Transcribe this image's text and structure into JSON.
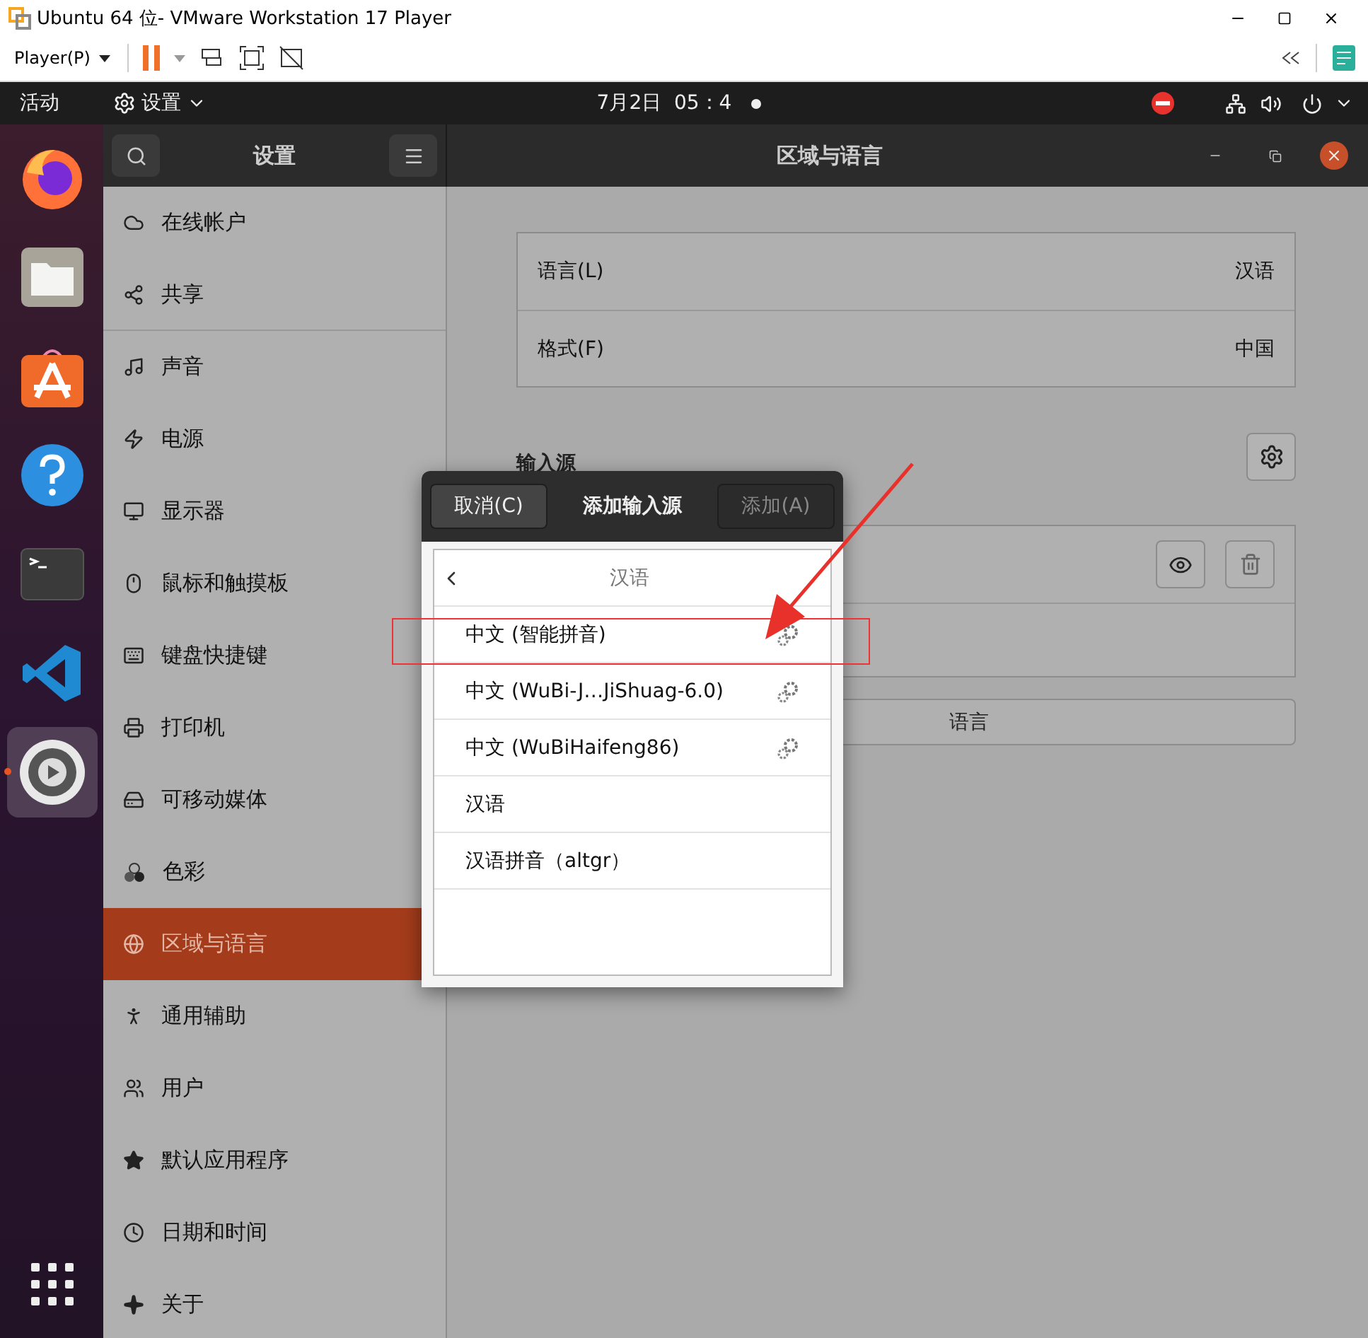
{
  "window": {
    "title": "Ubuntu 64 位- VMware Workstation 17 Player"
  },
  "vm_toolbar": {
    "player_menu": "Player(P)"
  },
  "top_bar": {
    "activities": "活动",
    "app_menu": "设置",
    "clock": "7月2日  05：4"
  },
  "dock": {
    "items": [
      {
        "kind": "firefox",
        "selected": false
      },
      {
        "kind": "files",
        "selected": false
      },
      {
        "kind": "store",
        "selected": false
      },
      {
        "kind": "help",
        "selected": false
      },
      {
        "kind": "terminal",
        "selected": false
      },
      {
        "kind": "vscode",
        "selected": false
      },
      {
        "kind": "settings",
        "selected": true
      }
    ]
  },
  "sidebar": {
    "title": "设置",
    "items": [
      {
        "label": "在线帐户",
        "selected": false
      },
      {
        "label": "共享",
        "selected": false
      },
      {
        "label": "声音",
        "selected": false
      },
      {
        "label": "电源",
        "selected": false
      },
      {
        "label": "显示器",
        "selected": false
      },
      {
        "label": "鼠标和触摸板",
        "selected": false
      },
      {
        "label": "键盘快捷键",
        "selected": false
      },
      {
        "label": "打印机",
        "selected": false
      },
      {
        "label": "可移动媒体",
        "selected": false
      },
      {
        "label": "色彩",
        "selected": false
      },
      {
        "label": "区域与语言",
        "selected": true
      },
      {
        "label": "通用辅助",
        "selected": false
      },
      {
        "label": "用户",
        "selected": false
      },
      {
        "label": "默认应用程序",
        "selected": false
      },
      {
        "label": "日期和时间",
        "selected": false
      },
      {
        "label": "关于",
        "selected": false
      }
    ]
  },
  "main": {
    "title": "区域与语言",
    "region_rows": [
      {
        "label": "语言(L)",
        "value": "汉语"
      },
      {
        "label": "格式(F)",
        "value": "中国"
      }
    ],
    "input_sources_heading": "输入源",
    "add_language_button": "语言"
  },
  "dialog": {
    "cancel": "取消(C)",
    "title": "添加输入源",
    "add": {
      "label": "添加(A)",
      "disabled": true
    },
    "back_label": "汉语",
    "items": [
      {
        "label": "中文 (智能拼音)",
        "has_settings": true
      },
      {
        "label": "中文 (WuBi-J…JiShuag-6.0)",
        "has_settings": true
      },
      {
        "label": "中文 (WuBiHaifeng86)",
        "has_settings": true
      },
      {
        "label": "汉语",
        "has_settings": false
      },
      {
        "label": "汉语拼音（altgr）",
        "has_settings": false
      }
    ]
  }
}
